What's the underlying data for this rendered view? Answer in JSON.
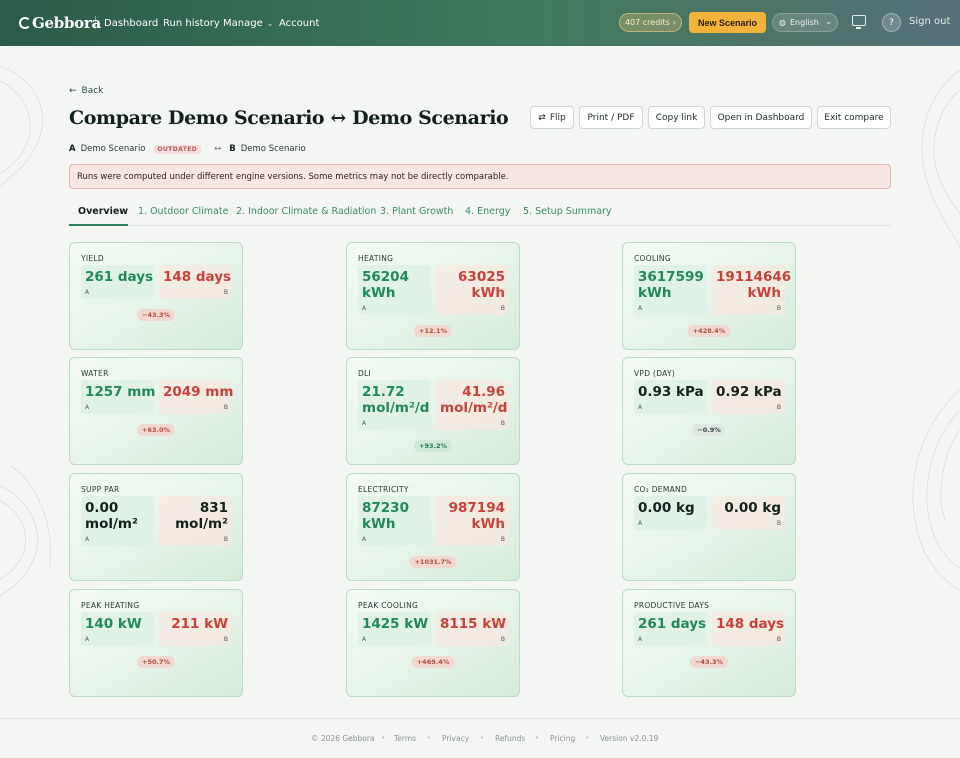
{
  "header": {
    "brand": "Gebbora",
    "nav": {
      "dashboard": "Dashboard",
      "run_history": "Run history",
      "manage": "Manage",
      "account": "Account"
    },
    "credits": "407 credits",
    "new_scenario": "New Scenario",
    "language": "English",
    "help": "?",
    "sign_out": "Sign out"
  },
  "page": {
    "back": "Back",
    "title": "Compare Demo Scenario ↔ Demo Scenario",
    "actions": {
      "flip": "Flip",
      "print": "Print / PDF",
      "copy_link": "Copy link",
      "open_dashboard": "Open in Dashboard",
      "exit_compare": "Exit compare"
    },
    "scenario_a": {
      "letter": "A",
      "name": "Demo Scenario",
      "badge": "OUTDATED"
    },
    "swap": "↔",
    "scenario_b": {
      "letter": "B",
      "name": "Demo Scenario"
    },
    "warning": "Runs were computed under different engine versions. Some metrics may not be directly comparable."
  },
  "tabs": [
    "Overview",
    "1. Outdoor Climate",
    "2. Indoor Climate & Radiation",
    "3. Plant Growth",
    "4. Energy",
    "5. Setup Summary"
  ],
  "cards": [
    {
      "label": "YIELD",
      "a": "261 days",
      "b": "148 days",
      "delta": "−43.3%",
      "tone": "bad"
    },
    {
      "label": "HEATING",
      "a": "56204\nkWh",
      "b": "63025\nkWh",
      "delta": "+12.1%",
      "tone": "bad"
    },
    {
      "label": "COOLING",
      "a": "3617599\nkWh",
      "b": "19114646\nkWh",
      "delta": "+428.4%",
      "tone": "bad"
    },
    {
      "label": "WATER",
      "a": "1257 mm",
      "b": "2049 mm",
      "delta": "+63.0%",
      "tone": "bad"
    },
    {
      "label": "DLI",
      "a": "21.72\nmol/m²/d",
      "b": "41.96\nmol/m²/d",
      "delta": "+93.2%",
      "tone": "good"
    },
    {
      "label": "VPD (DAY)",
      "a": "0.93 kPa",
      "b": "0.92 kPa",
      "delta": "−0.9%",
      "tone": "neu"
    },
    {
      "label": "SUPP PAR",
      "a": "0.00\nmol/m²",
      "b": "831\nmol/m²",
      "delta": "",
      "tone": "none"
    },
    {
      "label": "ELECTRICITY",
      "a": "87230\nkWh",
      "b": "987194\nkWh",
      "delta": "+1031.7%",
      "tone": "bad"
    },
    {
      "label": "CO₂ DEMAND",
      "a": "0.00 kg",
      "b": "0.00 kg",
      "delta": "",
      "tone": "none"
    },
    {
      "label": "PEAK HEATING",
      "a": "140 kW",
      "b": "211 kW",
      "delta": "+50.7%",
      "tone": "bad"
    },
    {
      "label": "PEAK COOLING",
      "a": "1425 kW",
      "b": "8115 kW",
      "delta": "+469.4%",
      "tone": "bad"
    },
    {
      "label": "PRODUCTIVE DAYS",
      "a": "261 days",
      "b": "148 days",
      "delta": "−43.3%",
      "tone": "bad"
    }
  ],
  "card_tags": {
    "a": "A",
    "b": "B"
  },
  "footer": {
    "copyright": "© 2026 Gebbora",
    "terms": "Terms",
    "privacy": "Privacy",
    "refunds": "Refunds",
    "pricing": "Pricing",
    "version": "Version v2.0.19"
  },
  "colors": {
    "accent_green": "#21895a",
    "negative_red": "#c8423b",
    "cta_orange": "#f3b23a",
    "topbar_green": "#2b5b48"
  }
}
